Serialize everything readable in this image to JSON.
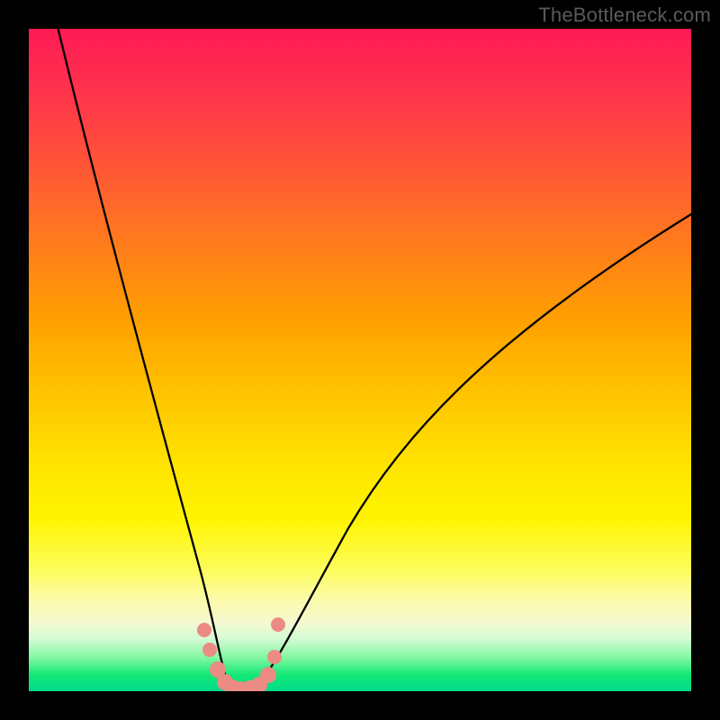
{
  "watermark": "TheBottleneck.com",
  "chart_data": {
    "type": "line",
    "title": "",
    "xlabel": "",
    "ylabel": "",
    "xlim": [
      0,
      100
    ],
    "ylim": [
      0,
      100
    ],
    "grid": false,
    "series": [
      {
        "name": "bottleneck-curve",
        "color": "#000000",
        "x": [
          2,
          6,
          10,
          14,
          18,
          21,
          24,
          26,
          28,
          29.5,
          31,
          33,
          35,
          37,
          39,
          41,
          44,
          48,
          54,
          62,
          72,
          84,
          100
        ],
        "y": [
          110,
          90,
          72,
          56,
          40,
          28,
          18,
          10,
          5,
          1.5,
          0.2,
          0.2,
          1,
          3,
          6,
          10,
          16,
          24,
          34,
          45,
          55,
          64,
          72
        ]
      },
      {
        "name": "marker-dots",
        "type": "scatter",
        "color": "#ec8b84",
        "x": [
          26.5,
          27.5,
          28.7,
          29.8,
          30.6,
          31.6,
          33.0,
          34.5,
          36.0,
          37.2,
          37.6
        ],
        "y": [
          9.0,
          6.5,
          3.0,
          0.8,
          0.3,
          0.2,
          0.3,
          0.8,
          2.5,
          5.8,
          10.0
        ]
      }
    ],
    "background_gradient_stops": [
      {
        "pos": 0.0,
        "color": "#ff1a55"
      },
      {
        "pos": 0.45,
        "color": "#ffa000"
      },
      {
        "pos": 0.75,
        "color": "#fff400"
      },
      {
        "pos": 0.92,
        "color": "#d5fbd5"
      },
      {
        "pos": 1.0,
        "color": "#00da8a"
      }
    ]
  }
}
